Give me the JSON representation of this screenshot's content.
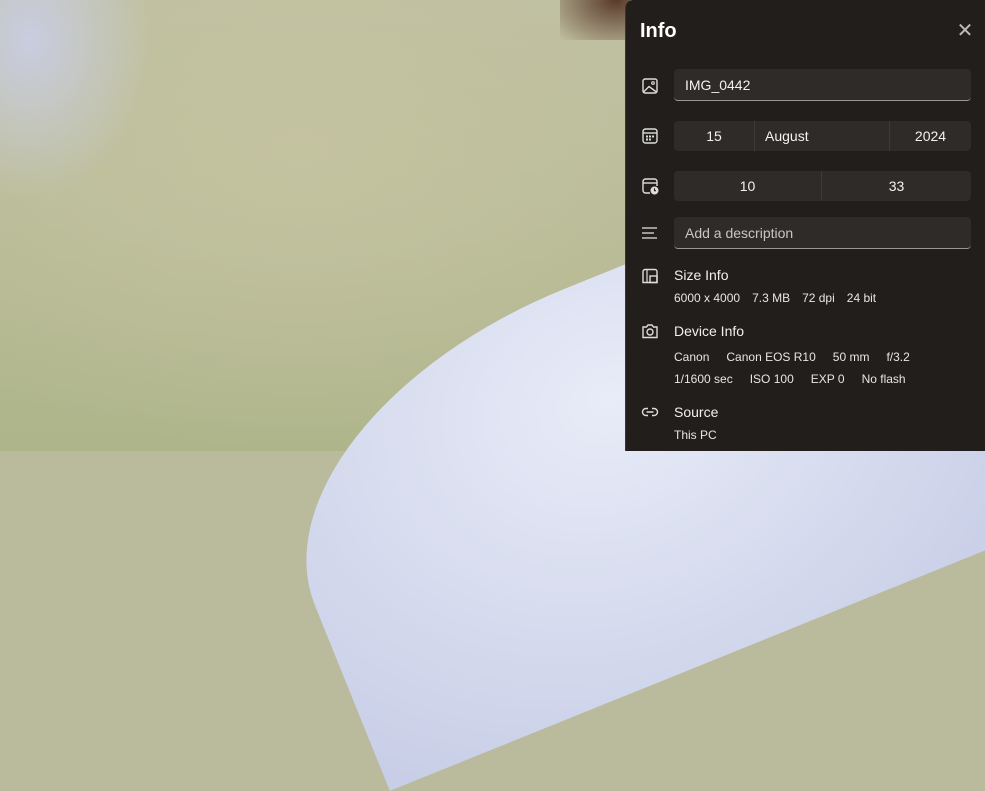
{
  "panel": {
    "title": "Info",
    "file_name": "IMG_0442",
    "date": {
      "day": "15",
      "month": "August",
      "year": "2024"
    },
    "time": {
      "hour": "10",
      "minute": "33"
    },
    "description_placeholder": "Add a description",
    "size_info": {
      "label": "Size Info",
      "values": [
        "6000 x 4000",
        "7.3 MB",
        "72 dpi",
        "24 bit"
      ]
    },
    "device_info": {
      "label": "Device Info",
      "row1": [
        "Canon",
        "Canon EOS R10",
        "50 mm",
        "f/3.2"
      ],
      "row2": [
        "1/1600 sec",
        "ISO 100",
        "EXP 0",
        "No flash"
      ]
    },
    "source": {
      "label": "Source",
      "value": "This PC"
    }
  }
}
